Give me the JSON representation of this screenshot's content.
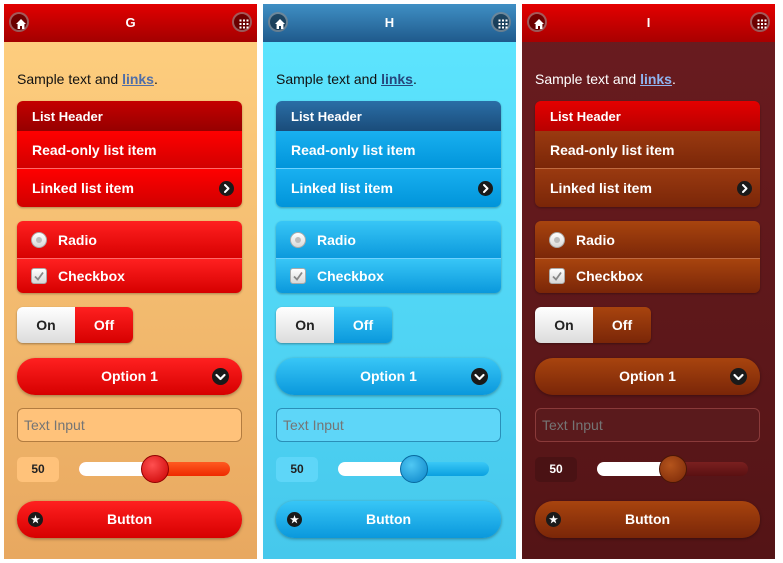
{
  "themes": [
    {
      "title": "G",
      "sample_text": "Sample text and ",
      "link_text": "links",
      "period": ".",
      "list_header": "List Header",
      "readonly_item": "Read-only list item",
      "linked_item": "Linked list item",
      "radio_label": "Radio",
      "checkbox_label": "Checkbox",
      "toggle_on": "On",
      "toggle_off": "Off",
      "select_value": "Option 1",
      "text_input_placeholder": "Text Input",
      "slider_value": "50",
      "slider_fraction": 0.5,
      "button_label": "Button",
      "colors": {
        "page_bg": "linear-gradient(#ffd080,#e8a860)",
        "header_bg": "linear-gradient(#e20000,#a30000)",
        "header_text": "#ffffff",
        "sample_text": "#111111",
        "link": "#4f6ea8",
        "list_header_bg": "linear-gradient(#c40000,#960000)",
        "item_bg": "linear-gradient(#ff0000,#d00000)",
        "item_text": "#ffffff",
        "divider": "#ff6a6a",
        "accent": "linear-gradient(#ff2020,#d60000)",
        "accent_text": "#ffffff",
        "input_bg": "#ffc27a",
        "input_border": "#b27c40",
        "input_text": "#333333",
        "slider_val_bg": "#ffc27a",
        "slider_val_text": "#222222",
        "track_fill": "#ffffff",
        "track_rest": "linear-gradient(#ff5a20,#ee2a00)",
        "thumb_bg": "radial-gradient(circle at 40% 35%,#ff5050,#c80000)",
        "thumb_border": "#900000"
      }
    },
    {
      "title": "H",
      "sample_text": "Sample text and ",
      "link_text": "links",
      "period": ".",
      "list_header": "List Header",
      "readonly_item": "Read-only list item",
      "linked_item": "Linked list item",
      "radio_label": "Radio",
      "checkbox_label": "Checkbox",
      "toggle_on": "On",
      "toggle_off": "Off",
      "select_value": "Option 1",
      "text_input_placeholder": "Text Input",
      "slider_value": "50",
      "slider_fraction": 0.5,
      "button_label": "Button",
      "colors": {
        "page_bg": "linear-gradient(#5ee6ff,#46c8ec)",
        "header_bg": "linear-gradient(#3f8fc4,#1f5a8c)",
        "header_text": "#ffffff",
        "sample_text": "#111111",
        "link": "#26467c",
        "list_header_bg": "linear-gradient(#2a6ea6,#1a4c7a)",
        "item_bg": "linear-gradient(#19b0f0,#0094da)",
        "item_text": "#ffffff",
        "divider": "#6fd2ff",
        "accent": "linear-gradient(#38c6f6,#0a98dc)",
        "accent_text": "#ffffff",
        "input_bg": "#5ed6f8",
        "input_border": "#2a8fb8",
        "input_text": "#333333",
        "slider_val_bg": "#5ed6f8",
        "slider_val_text": "#222222",
        "track_fill": "#ffffff",
        "track_rest": "linear-gradient(#3ac8f6,#0aa0e0)",
        "thumb_bg": "radial-gradient(circle at 40% 35%,#50c8f4,#0a84c8)",
        "thumb_border": "#086aa0"
      }
    },
    {
      "title": "I",
      "sample_text": "Sample text and ",
      "link_text": "links",
      "period": ".",
      "list_header": "List Header",
      "readonly_item": "Read-only list item",
      "linked_item": "Linked list item",
      "radio_label": "Radio",
      "checkbox_label": "Checkbox",
      "toggle_on": "On",
      "toggle_off": "Off",
      "select_value": "Option 1",
      "text_input_placeholder": "Text Input",
      "slider_value": "50",
      "slider_fraction": 0.5,
      "button_label": "Button",
      "colors": {
        "page_bg": "linear-gradient(#6a1c20,#541416)",
        "header_bg": "linear-gradient(#e40000,#a80000)",
        "header_text": "#ffffff",
        "sample_text": "#ffffff",
        "link": "#8fb4f0",
        "list_header_bg": "linear-gradient(#e40000,#b80000)",
        "item_bg": "linear-gradient(#9a3a10,#7a2608)",
        "item_text": "#ffffff",
        "divider": "#c06a40",
        "accent": "linear-gradient(#a8440e,#7a2608)",
        "accent_text": "#ffffff",
        "input_bg": "#5a1a1c",
        "input_border": "#8a3a3a",
        "input_text": "#ffffff",
        "slider_val_bg": "#4a1214",
        "slider_val_text": "#ffffff",
        "track_fill": "#ffffff",
        "track_rest": "linear-gradient(#7a2020,#5a1012)",
        "thumb_bg": "radial-gradient(circle at 40% 35%,#b4541c,#7a2808)",
        "thumb_border": "#4a1606"
      }
    }
  ]
}
